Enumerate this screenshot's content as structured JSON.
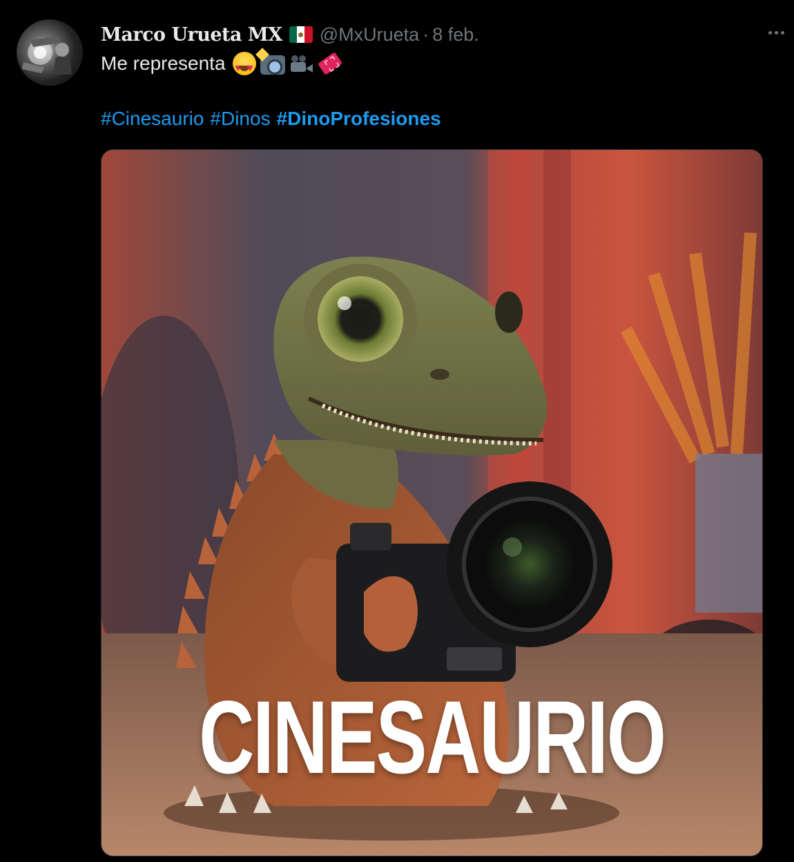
{
  "tweet": {
    "display_name": "Marco Urueta MX",
    "handle": "@MxUrueta",
    "separator": "·",
    "date": "8 feb.",
    "text": "Me representa",
    "emojis": [
      "smiling-face-heart-eyes",
      "camera-with-flash",
      "movie-camera",
      "ticket"
    ],
    "hashtags": [
      {
        "label": "#Cinesaurio",
        "bold": false
      },
      {
        "label": "#Dinos",
        "bold": false
      },
      {
        "label": "#DinoProfesiones",
        "bold": true
      }
    ],
    "image": {
      "caption": "CINESAURIO",
      "subject": "dinosaur-with-camera"
    }
  },
  "colors": {
    "background": "#000000",
    "text": "#e7e9ea",
    "secondary": "#71767b",
    "link": "#1d9bf0",
    "border": "#2f3336"
  },
  "icons": {
    "more": "more-horizontal-icon",
    "flag": "mexico-flag-icon"
  }
}
